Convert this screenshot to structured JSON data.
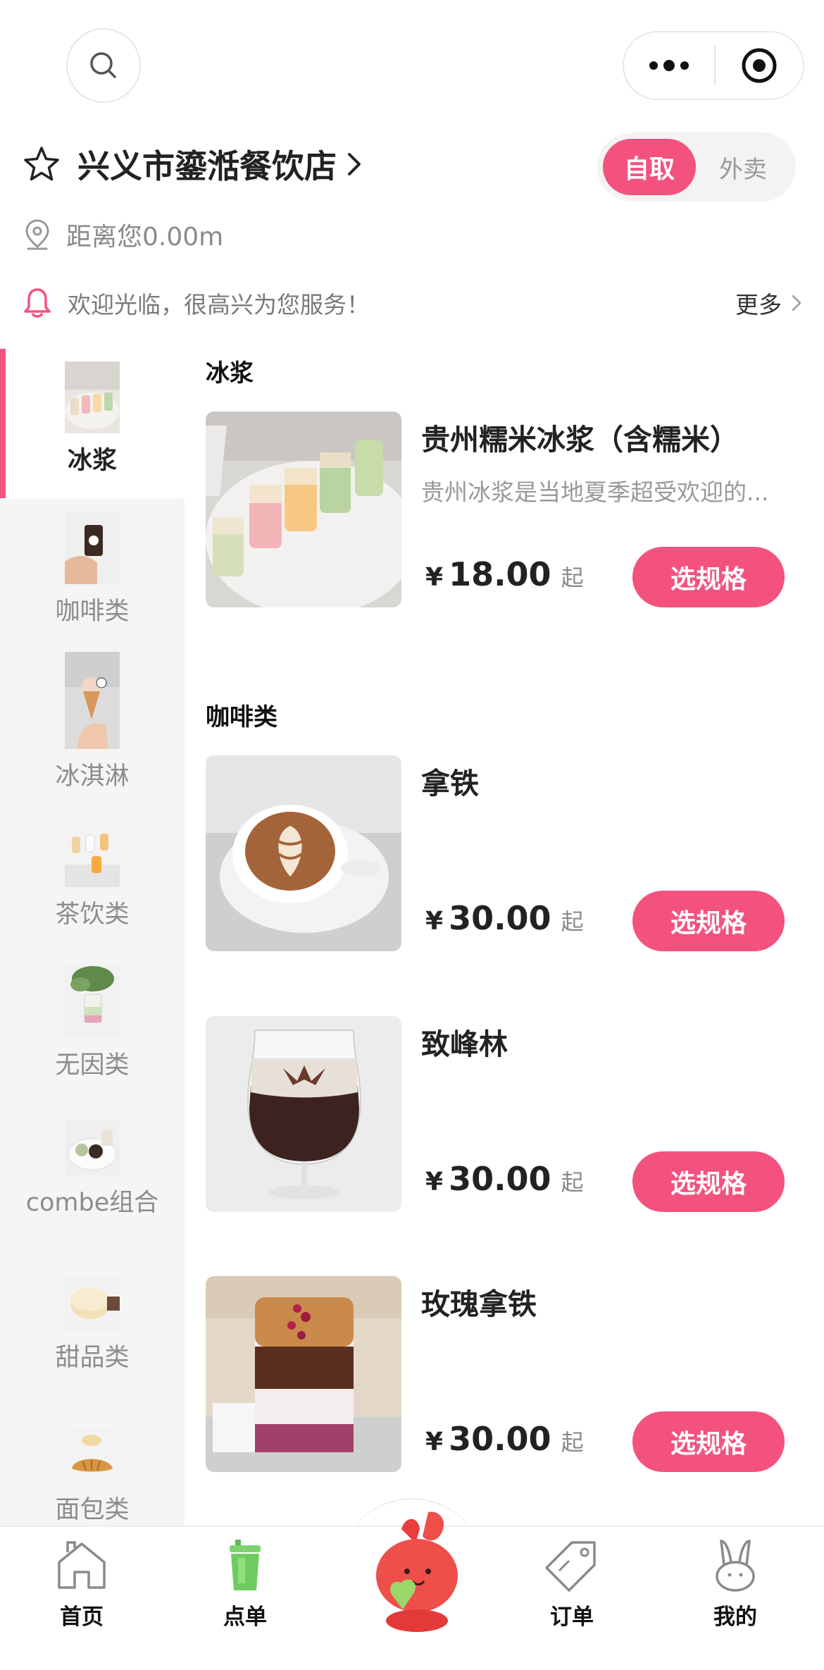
{
  "header": {
    "search_icon": "search-icon",
    "more_icon": "more-dots-icon",
    "target_icon": "target-icon"
  },
  "store": {
    "name": "兴义市鎏湉餐饮店",
    "distance": "距离您0.00m",
    "notice": "欢迎光临，很高兴为您服务！",
    "notice_more": "更多",
    "mode_pickup": "自取",
    "mode_delivery": "外卖",
    "accent_color": "#f3527f"
  },
  "categories": [
    {
      "label": "冰浆",
      "active": true
    },
    {
      "label": "咖啡类",
      "active": false
    },
    {
      "label": "冰淇淋",
      "active": false
    },
    {
      "label": "茶饮类",
      "active": false
    },
    {
      "label": "无因类",
      "active": false
    },
    {
      "label": "combe组合",
      "active": false
    },
    {
      "label": "甜品类",
      "active": false
    },
    {
      "label": "面包类",
      "active": false
    }
  ],
  "sections": [
    {
      "title": "冰浆",
      "products": [
        {
          "name": "贵州糯米冰浆（含糯米）",
          "desc": "贵州冰浆是当地夏季超受欢迎的...",
          "currency": "¥",
          "price": "18.00",
          "suffix": "起",
          "button": "选规格"
        }
      ]
    },
    {
      "title": "咖啡类",
      "products": [
        {
          "name": "拿铁",
          "desc": "",
          "currency": "¥",
          "price": "30.00",
          "suffix": "起",
          "button": "选规格"
        },
        {
          "name": "致峰林",
          "desc": "",
          "currency": "¥",
          "price": "30.00",
          "suffix": "起",
          "button": "选规格"
        },
        {
          "name": "玫瑰拿铁",
          "desc": "",
          "currency": "¥",
          "price": "30.00",
          "suffix": "起",
          "button": "选规格"
        }
      ]
    }
  ],
  "tabbar": [
    {
      "label": "首页",
      "icon": "home-icon"
    },
    {
      "label": "点单",
      "icon": "cup-icon"
    },
    {
      "label": "",
      "icon": "mascot-icon"
    },
    {
      "label": "订单",
      "icon": "tag-icon"
    },
    {
      "label": "我的",
      "icon": "rabbit-icon"
    }
  ]
}
